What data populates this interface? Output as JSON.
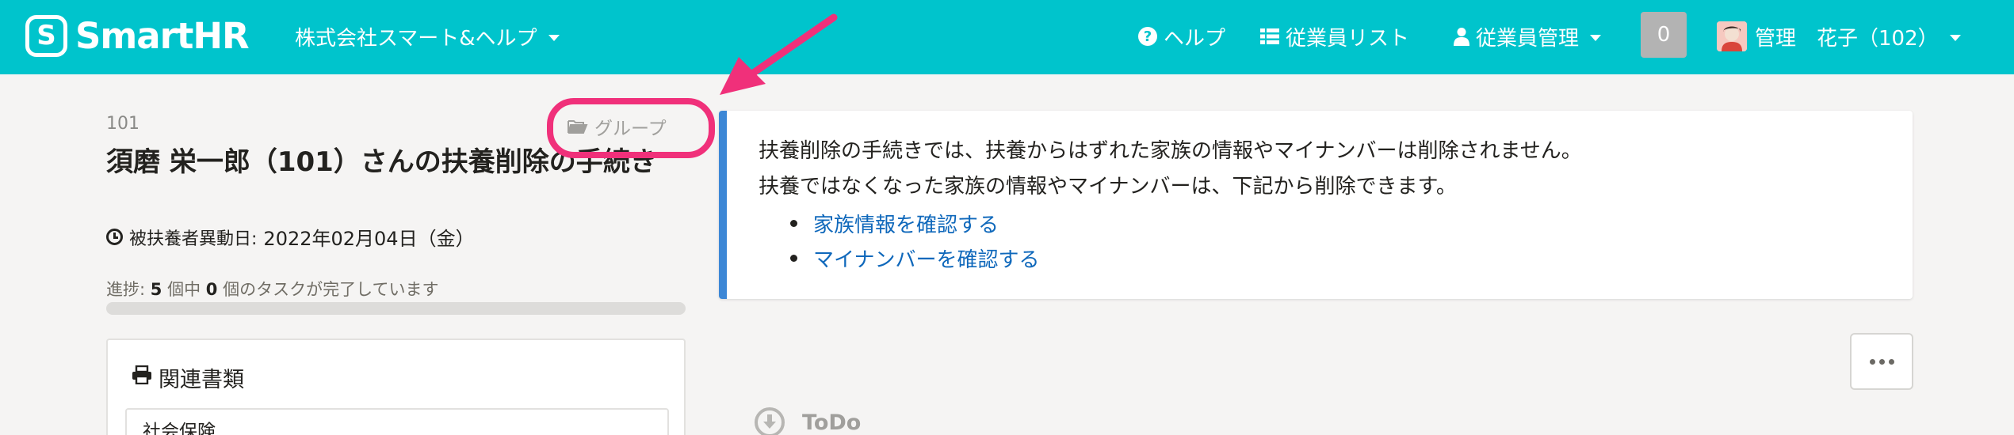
{
  "header": {
    "logo_text": "SmartHR",
    "logo_mark": "S",
    "company_name": "株式会社スマート&ヘルプ",
    "nav": {
      "help": "ヘルプ",
      "employee_list": "従業員リスト",
      "employee_management": "従業員管理"
    },
    "notification_count": "0",
    "user_name": "管理　花子（102）",
    "brand_color": "#00c4cc"
  },
  "procedure": {
    "employee_number": "101",
    "group_label": "グループ",
    "title": "須磨 栄一郎（101）さんの扶養削除の手続き",
    "change_date_label": "被扶養者異動日:",
    "change_date_value": "2022年02月04日（金）",
    "progress": {
      "prefix": "進捗:",
      "total": "5",
      "middle": "個中",
      "done": "0",
      "suffix": "個のタスクが完了しています",
      "fraction": 0
    }
  },
  "related_docs": {
    "header": "関連書類",
    "first_item": "社会保険"
  },
  "notice": {
    "line1": "扶養削除の手続きでは、扶養からはずれた家族の情報やマイナンバーは削除されません。",
    "line2": "扶養ではなくなった家族の情報やマイナンバーは、下記から削除できます。",
    "links": [
      "家族情報を確認する",
      "マイナンバーを確認する"
    ],
    "accent_color": "#3c87d6"
  },
  "todo_label": "ToDo",
  "annotation_color": "#f0307a"
}
